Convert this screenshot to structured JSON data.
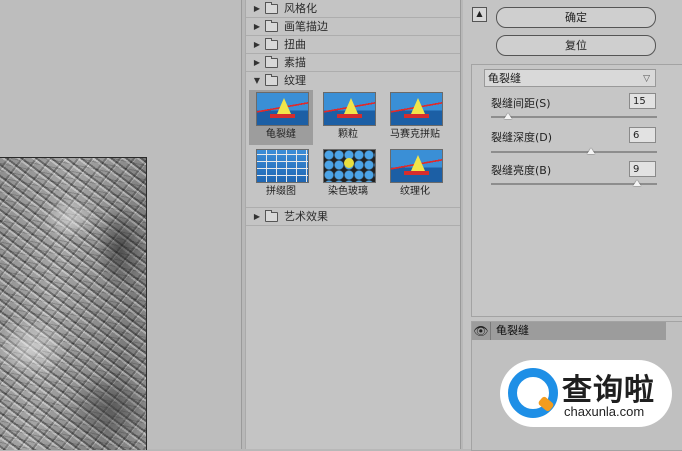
{
  "gallery": {
    "categories_top": [
      {
        "label": "风格化"
      },
      {
        "label": "画笔描边"
      },
      {
        "label": "扭曲"
      },
      {
        "label": "素描"
      }
    ],
    "open_category": {
      "label": "纹理"
    },
    "thumbnails": [
      {
        "label": "龟裂缝",
        "selected": true
      },
      {
        "label": "颗粒",
        "selected": false
      },
      {
        "label": "马赛克拼贴",
        "selected": false
      },
      {
        "label": "拼缀图",
        "selected": false
      },
      {
        "label": "染色玻璃",
        "selected": false
      },
      {
        "label": "纹理化",
        "selected": false
      }
    ],
    "category_bottom": {
      "label": "艺术效果"
    }
  },
  "settings": {
    "ok_label": "确定",
    "reset_label": "复位",
    "filter_select": "龟裂缝",
    "params": [
      {
        "label": "裂缝间距(S)",
        "value": "15",
        "slider_fraction": 0.1
      },
      {
        "label": "裂缝深度(D)",
        "value": "6",
        "slider_fraction": 0.6
      },
      {
        "label": "裂缝亮度(B)",
        "value": "9",
        "slider_fraction": 0.88
      }
    ],
    "layer_name": "龟裂缝"
  },
  "watermark": {
    "chinese": "查询啦",
    "url": "chaxunla.com"
  }
}
